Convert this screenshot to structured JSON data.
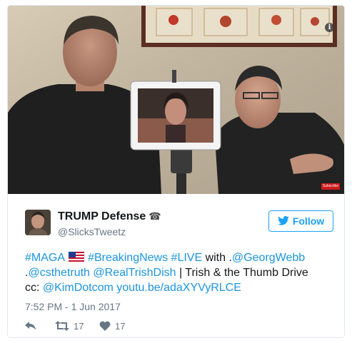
{
  "tweet": {
    "media": {
      "icons": [
        "info-icon",
        "youtube-subscribe-badge"
      ],
      "badge_label": "Subscribe"
    },
    "user": {
      "display_name": "TRUMP Defense",
      "name_icon": "telephone-icon",
      "phone_glyph": "☎",
      "handle": "@SlicksTweetz"
    },
    "follow_button": {
      "label": "Follow",
      "icon": "twitter-bird-icon",
      "color": "#1da1f2"
    },
    "text": {
      "line1": [
        {
          "t": "#MAGA",
          "link": true
        },
        {
          "t": " ",
          "link": false
        },
        {
          "t": "flag",
          "emoji": "us-flag"
        },
        {
          "t": " #BreakingNews",
          "link": true
        },
        {
          "t": " #LIVE",
          "link": true
        },
        {
          "t": " with .",
          "link": false
        },
        {
          "t": "@GeorgWebb",
          "link": true
        }
      ],
      "line2": [
        {
          "t": ".",
          "link": false
        },
        {
          "t": "@csthetruth",
          "link": true
        },
        {
          "t": " ",
          "link": false
        },
        {
          "t": "@RealTrishDish",
          "link": true
        },
        {
          "t": " | Trish & the Thumb Drive",
          "link": false
        }
      ],
      "line3": [
        {
          "t": "cc: ",
          "link": false
        },
        {
          "t": "@KimDotcom",
          "link": true
        },
        {
          "t": " ",
          "link": false
        },
        {
          "t": "youtu.be/adaXYVyRLCE",
          "link": true
        }
      ],
      "link_color": "#1b95e0"
    },
    "timestamp": "7:52 PM - 1 Jun 2017",
    "actions": {
      "reply": {
        "icon": "reply-icon"
      },
      "retweet": {
        "icon": "retweet-icon",
        "count": "17"
      },
      "like": {
        "icon": "heart-icon",
        "count": "17"
      }
    }
  }
}
